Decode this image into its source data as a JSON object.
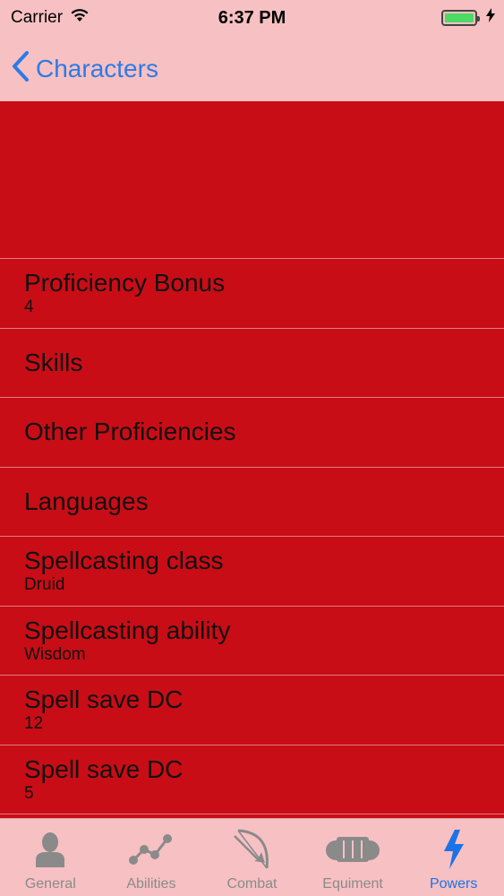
{
  "status_bar": {
    "carrier": "Carrier",
    "time": "6:37 PM"
  },
  "nav": {
    "back_label": "Characters"
  },
  "rows": [
    {
      "title": "Proficiency Bonus",
      "subtitle": "4"
    },
    {
      "title": "Skills",
      "subtitle": ""
    },
    {
      "title": "Other Proficiencies",
      "subtitle": ""
    },
    {
      "title": "Languages",
      "subtitle": ""
    },
    {
      "title": "Spellcasting class",
      "subtitle": "Druid"
    },
    {
      "title": "Spellcasting ability",
      "subtitle": "Wisdom"
    },
    {
      "title": "Spell save DC",
      "subtitle": "12"
    },
    {
      "title": "Spell save DC",
      "subtitle": "5"
    }
  ],
  "tabs": [
    {
      "label": "General",
      "icon": "person-icon"
    },
    {
      "label": "Abilities",
      "icon": "graph-icon"
    },
    {
      "label": "Combat",
      "icon": "bow-icon"
    },
    {
      "label": "Equiment",
      "icon": "armor-icon"
    },
    {
      "label": "Powers",
      "icon": "lightning-icon"
    }
  ],
  "colors": {
    "background": "#f7c0c3",
    "content": "#c80d16",
    "accent": "#1a73e8",
    "battery": "#4cd964"
  }
}
